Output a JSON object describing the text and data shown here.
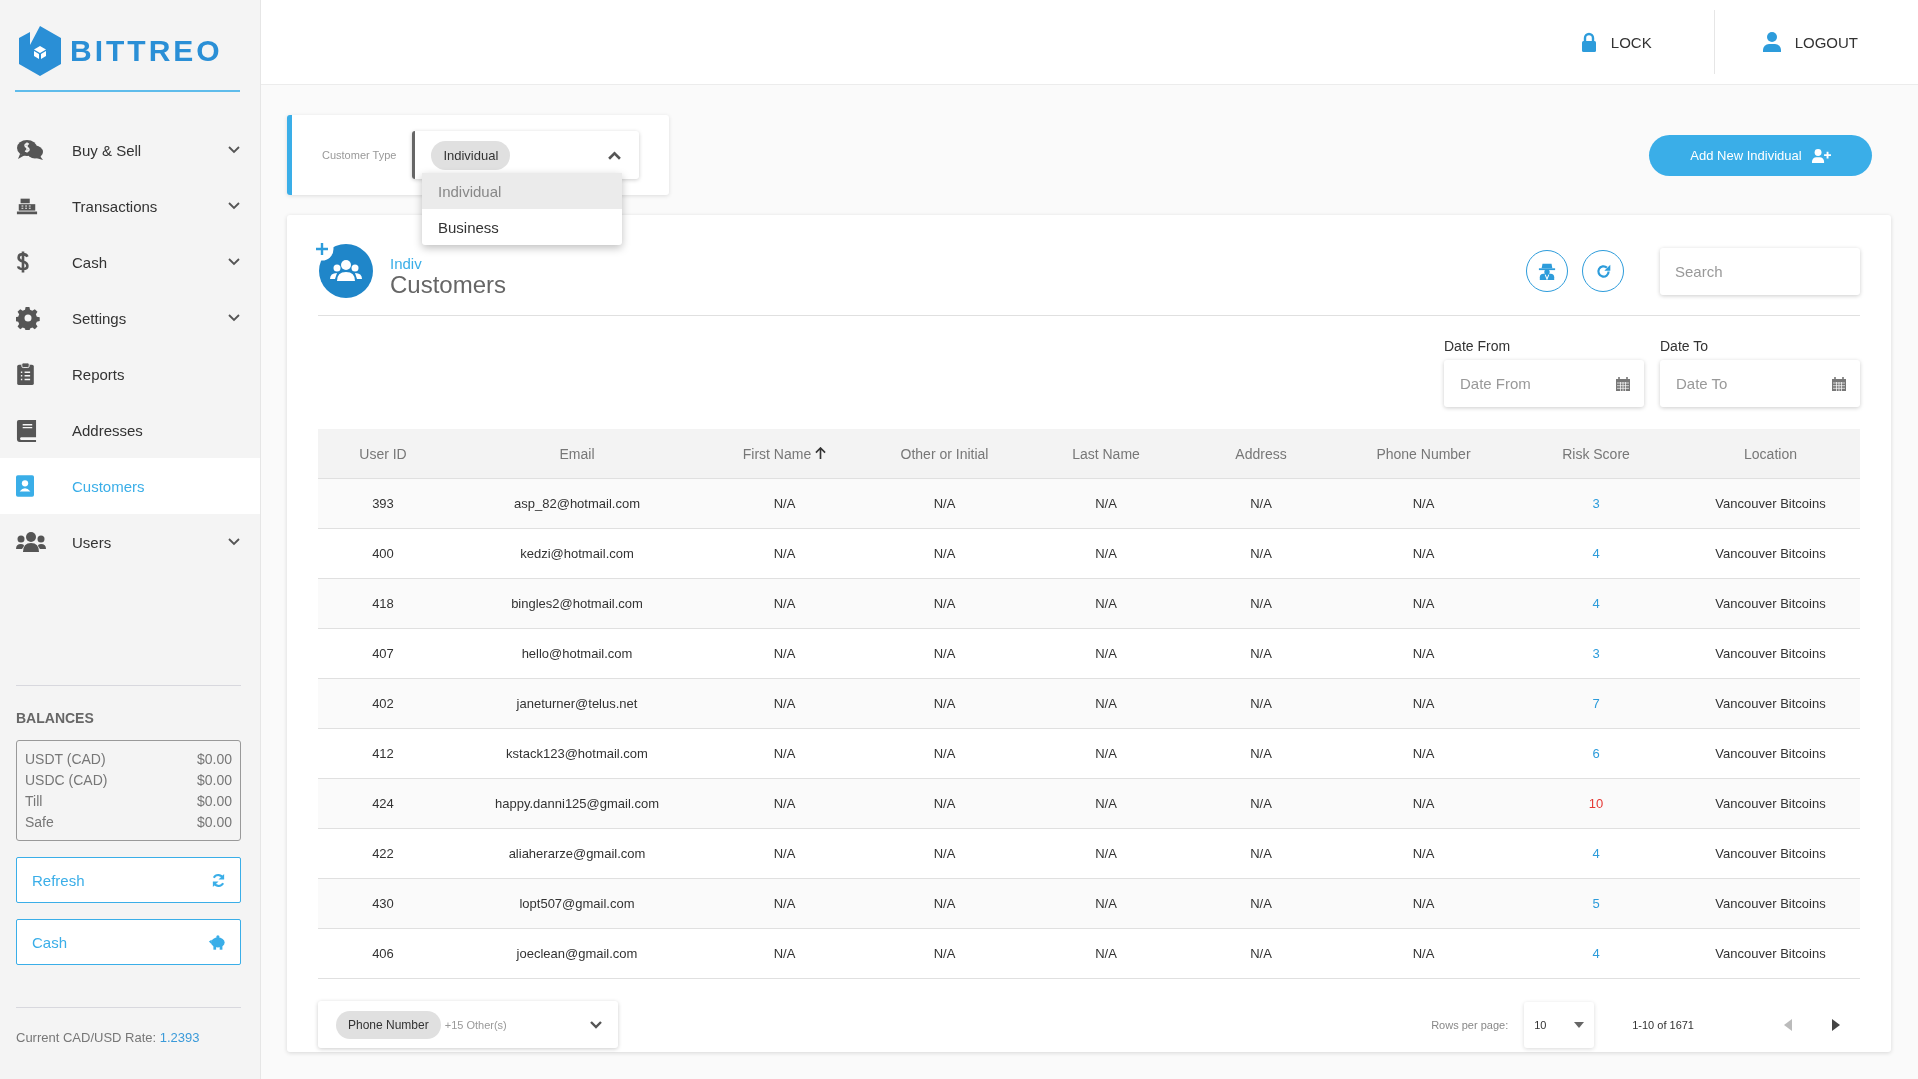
{
  "brand": "BITTREO",
  "sidebar": {
    "items": [
      {
        "label": "Buy & Sell",
        "kind": "chat-dollar",
        "expandable": true,
        "selected": false
      },
      {
        "label": "Transactions",
        "kind": "register",
        "expandable": true,
        "selected": false
      },
      {
        "label": "Cash",
        "kind": "dollar",
        "expandable": true,
        "selected": false
      },
      {
        "label": "Settings",
        "kind": "gear",
        "expandable": true,
        "selected": false
      },
      {
        "label": "Reports",
        "kind": "clipboard",
        "expandable": false,
        "selected": false
      },
      {
        "label": "Addresses",
        "kind": "book",
        "expandable": false,
        "selected": false
      },
      {
        "label": "Customers",
        "kind": "contact",
        "expandable": false,
        "selected": true
      },
      {
        "label": "Users",
        "kind": "users",
        "expandable": true,
        "selected": false
      }
    ],
    "balances_title": "BALANCES",
    "balances": [
      {
        "name": "USDT (CAD)",
        "amount": "$0.00"
      },
      {
        "name": "USDC (CAD)",
        "amount": "$0.00"
      },
      {
        "name": "Till",
        "amount": "$0.00"
      },
      {
        "name": "Safe",
        "amount": "$0.00"
      }
    ],
    "buttons": [
      {
        "label": "Refresh",
        "kind": "refresh"
      },
      {
        "label": "Cash",
        "kind": "piggy"
      }
    ],
    "rate_label": "Current CAD/USD Rate:",
    "rate_value": "1.2393"
  },
  "topbar": {
    "actions": [
      {
        "label": "LOCK",
        "kind": "lock"
      },
      {
        "label": "LOGOUT",
        "kind": "user"
      }
    ]
  },
  "customer_type": {
    "label": "Customer Type",
    "value": "Individual",
    "expanded": true,
    "options": [
      {
        "label": "Individual",
        "selected": true
      },
      {
        "label": "Business",
        "selected": false
      }
    ]
  },
  "add_button": "Add New Individual",
  "card": {
    "subtitle": "Indiv",
    "title": "Customers",
    "search": {
      "placeholder": "Search"
    },
    "date_from": {
      "label": "Date From",
      "placeholder": "Date From"
    },
    "date_to": {
      "label": "Date To",
      "placeholder": "Date To"
    }
  },
  "table": {
    "columns": [
      {
        "label": "User ID",
        "sorted": false
      },
      {
        "label": "Email",
        "sorted": false
      },
      {
        "label": "First Name",
        "sorted": true
      },
      {
        "label": "Other or Initial",
        "sorted": false
      },
      {
        "label": "Last Name",
        "sorted": false
      },
      {
        "label": "Address",
        "sorted": false
      },
      {
        "label": "Phone Number",
        "sorted": false
      },
      {
        "label": "Risk Score",
        "sorted": false
      },
      {
        "label": "Location",
        "sorted": false
      }
    ],
    "rows": [
      {
        "cells": [
          "393",
          "asp_82@hotmail.com",
          "N/A",
          "N/A",
          "N/A",
          "N/A",
          "N/A",
          "3",
          "Vancouver Bitcoins"
        ],
        "color": "#2d9cdb"
      },
      {
        "cells": [
          "400",
          "kedzi@hotmail.com",
          "N/A",
          "N/A",
          "N/A",
          "N/A",
          "N/A",
          "4",
          "Vancouver Bitcoins"
        ],
        "color": "#2d9cdb"
      },
      {
        "cells": [
          "418",
          "bingles2@hotmail.com",
          "N/A",
          "N/A",
          "N/A",
          "N/A",
          "N/A",
          "4",
          "Vancouver Bitcoins"
        ],
        "color": "#2d9cdb"
      },
      {
        "cells": [
          "407",
          "hello@hotmail.com",
          "N/A",
          "N/A",
          "N/A",
          "N/A",
          "N/A",
          "3",
          "Vancouver Bitcoins"
        ],
        "color": "#2d9cdb"
      },
      {
        "cells": [
          "402",
          "janeturner@telus.net",
          "N/A",
          "N/A",
          "N/A",
          "N/A",
          "N/A",
          "7",
          "Vancouver Bitcoins"
        ],
        "color": "#2d9cdb"
      },
      {
        "cells": [
          "412",
          "kstack123@hotmail.com",
          "N/A",
          "N/A",
          "N/A",
          "N/A",
          "N/A",
          "6",
          "Vancouver Bitcoins"
        ],
        "color": "#2d9cdb"
      },
      {
        "cells": [
          "424",
          "happy.danni125@gmail.com",
          "N/A",
          "N/A",
          "N/A",
          "N/A",
          "N/A",
          "10",
          "Vancouver Bitcoins"
        ],
        "color": "#e53935"
      },
      {
        "cells": [
          "422",
          "aliaherarze@gmail.com",
          "N/A",
          "N/A",
          "N/A",
          "N/A",
          "N/A",
          "4",
          "Vancouver Bitcoins"
        ],
        "color": "#2d9cdb"
      },
      {
        "cells": [
          "430",
          "lopt507@gmail.com",
          "N/A",
          "N/A",
          "N/A",
          "N/A",
          "N/A",
          "5",
          "Vancouver Bitcoins"
        ],
        "color": "#2d9cdb"
      },
      {
        "cells": [
          "406",
          "joeclean@gmail.com",
          "N/A",
          "N/A",
          "N/A",
          "N/A",
          "N/A",
          "4",
          "Vancouver Bitcoins"
        ],
        "color": "#2d9cdb"
      }
    ]
  },
  "footer": {
    "columns_chip": "Phone Number",
    "columns_more": "+15 Other(s)",
    "rows_label": "Rows per page:",
    "rows_value": "10",
    "range": "1-10 of 1671"
  }
}
